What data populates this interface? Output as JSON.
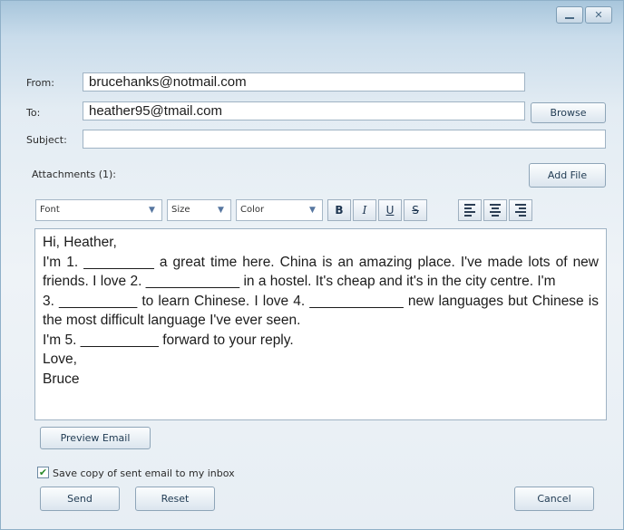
{
  "window": {
    "minimize_icon": "minimize-icon",
    "close_glyph": "✕"
  },
  "form": {
    "from_label": "From:",
    "from_value": "brucehanks@notmail.com",
    "to_label": "To:",
    "to_value": "heather95@tmail.com",
    "browse_label": "Browse",
    "subject_label": "Subject:",
    "subject_value": "",
    "attachments_label": "Attachments (1):",
    "add_file_label": "Add File"
  },
  "toolbar": {
    "font": "Font",
    "size": "Size",
    "color": "Color",
    "bold": "B",
    "italic": "I",
    "underline": "U",
    "strike": "S"
  },
  "body_lines": [
    "Hi, Heather,",
    "I'm 1. _________ a great time here. China is an amazing place. I've made lots of new",
    "friends. I love 2. ____________ in a hostel. It's cheap and it's in the city centre. I'm",
    "3. __________ to learn Chinese. I love 4. ____________ new languages but Chinese is",
    "the most difficult language I've ever seen.",
    "I'm 5. __________ forward to your reply.",
    "Love,",
    "Bruce"
  ],
  "footer": {
    "preview_label": "Preview Email",
    "save_copy_label": "Save copy of sent email to my inbox",
    "save_copy_checked": true,
    "send_label": "Send",
    "reset_label": "Reset",
    "cancel_label": "Cancel"
  },
  "colors": {
    "accent": "#5676a0",
    "check": "#2a8a2a"
  }
}
